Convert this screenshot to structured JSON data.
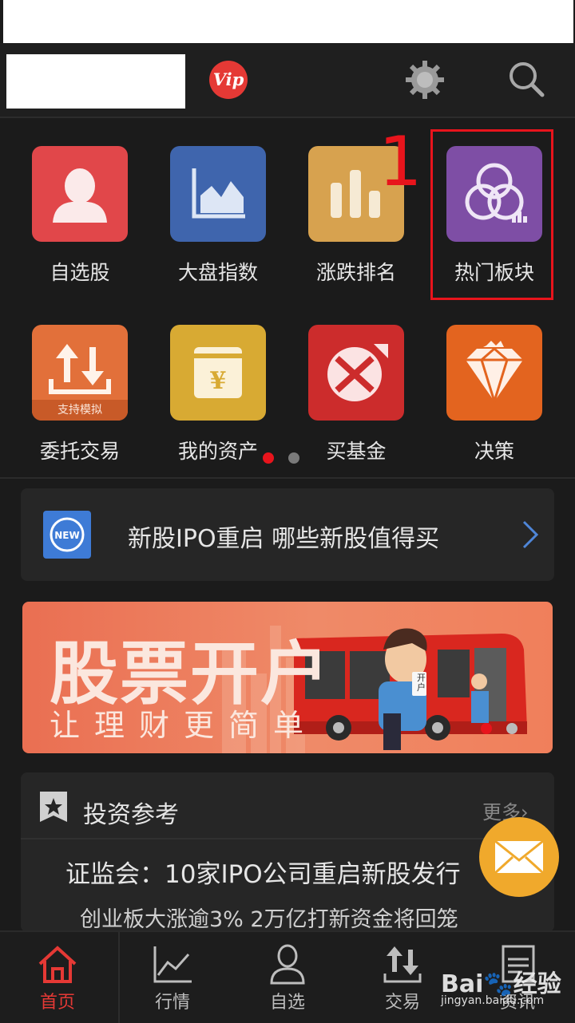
{
  "header": {
    "vip_label": "Vip"
  },
  "grid": {
    "items": [
      {
        "label": "自选股",
        "icon": "person-icon",
        "color": "#e1474a"
      },
      {
        "label": "大盘指数",
        "icon": "area-chart-icon",
        "color": "#3f65ad"
      },
      {
        "label": "涨跌排名",
        "icon": "bar-chart-icon",
        "color": "#d7a24f"
      },
      {
        "label": "热门板块",
        "icon": "circles-icon",
        "color": "#7e4ea5"
      },
      {
        "label": "委托交易",
        "icon": "transfer-icon",
        "color": "#e2703a",
        "badge": "支持模拟"
      },
      {
        "label": "我的资产",
        "icon": "yuan-wallet-icon",
        "color": "#d8aa33"
      },
      {
        "label": "买基金",
        "icon": "fund-icon",
        "color": "#cc2c2c"
      },
      {
        "label": "决策",
        "icon": "diamond-icon",
        "color": "#e3641f"
      }
    ],
    "annotation_number": "1",
    "active_page": 1,
    "page_count": 2
  },
  "news": {
    "badge": "NEW",
    "text": "新股IPO重启 哪些新股值得买"
  },
  "banner": {
    "title": "股票开户",
    "subtitle": "让理财更简单",
    "phone_text": "开户"
  },
  "reference": {
    "title": "投资参考",
    "more": "更多",
    "headline1": "证监会：10家IPO公司重启新股发行",
    "headline2": "创业板大涨逾3% 2万亿打新资金将回笼"
  },
  "tabs": [
    {
      "label": "首页",
      "active": true
    },
    {
      "label": "行情",
      "active": false
    },
    {
      "label": "自选",
      "active": false
    },
    {
      "label": "交易",
      "active": false
    },
    {
      "label": "资讯",
      "active": false
    }
  ],
  "colors": {
    "accent": "#e8141c",
    "active_tab": "#e53935",
    "background": "#1b1b1b"
  }
}
